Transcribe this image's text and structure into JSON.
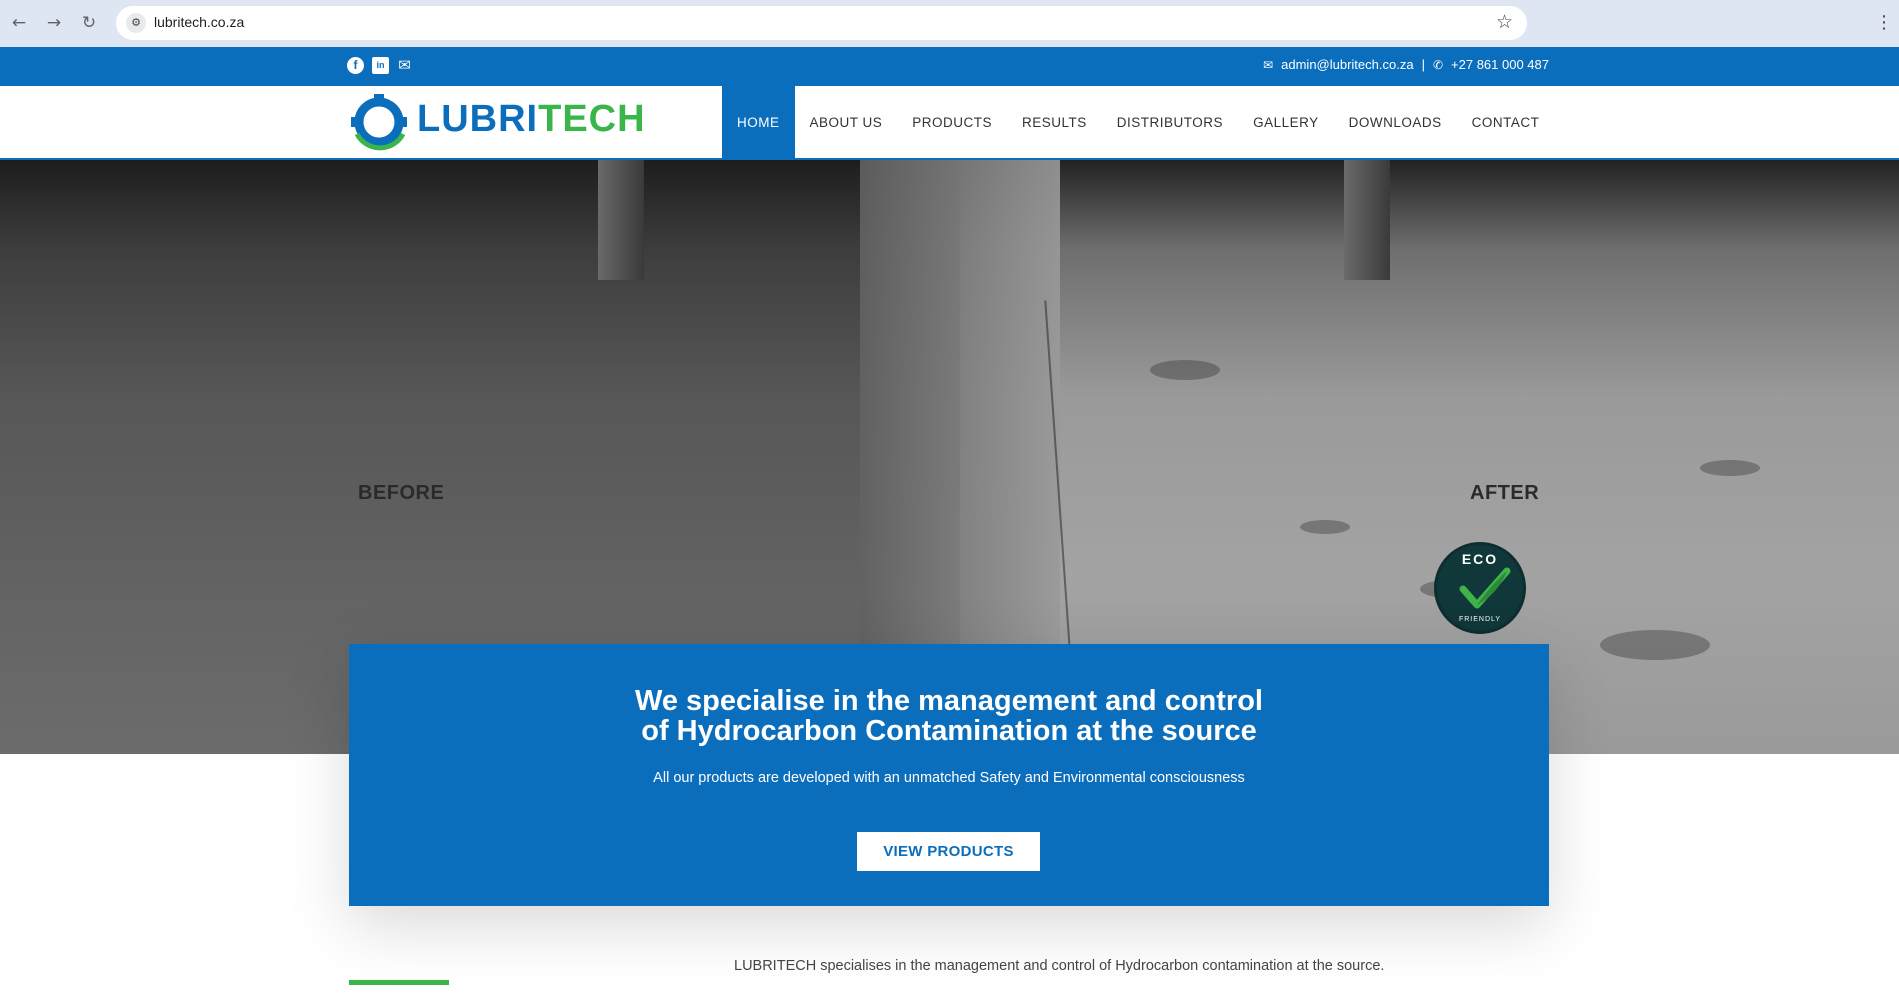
{
  "browser": {
    "url": "lubritech.co.za",
    "back_icon": "←",
    "forward_icon": "→",
    "reload_icon": "↻",
    "star_icon": "☆"
  },
  "topbar": {
    "email": "admin@lubritech.co.za",
    "separator": "|",
    "phone": "+27 861 000 487"
  },
  "logo": {
    "text_blue": "LUBRI",
    "text_green": "TECH"
  },
  "menu": [
    {
      "label": "HOME",
      "active": true
    },
    {
      "label": "ABOUT US"
    },
    {
      "label": "PRODUCTS"
    },
    {
      "label": "RESULTS"
    },
    {
      "label": "DISTRIBUTORS"
    },
    {
      "label": "GALLERY"
    },
    {
      "label": "DOWNLOADS"
    },
    {
      "label": "CONTACT"
    }
  ],
  "hero": {
    "before_label": "BEFORE",
    "after_label": "AFTER",
    "eco_badge_top": "ECO",
    "eco_badge_bottom": "FRIENDLY"
  },
  "promo": {
    "heading_line1": "We specialise in the management and control",
    "heading_line2": "of Hydrocarbon Contamination at the source",
    "subtext": "All our products are developed with an unmatched Safety and Environmental consciousness",
    "button": "VIEW PRODUCTS"
  },
  "intro": {
    "text": "LUBRITECH specialises in the management and control of Hydrocarbon contamination at the source."
  },
  "colors": {
    "brand_blue": "#0a6ebd",
    "brand_green": "#39b54a"
  }
}
